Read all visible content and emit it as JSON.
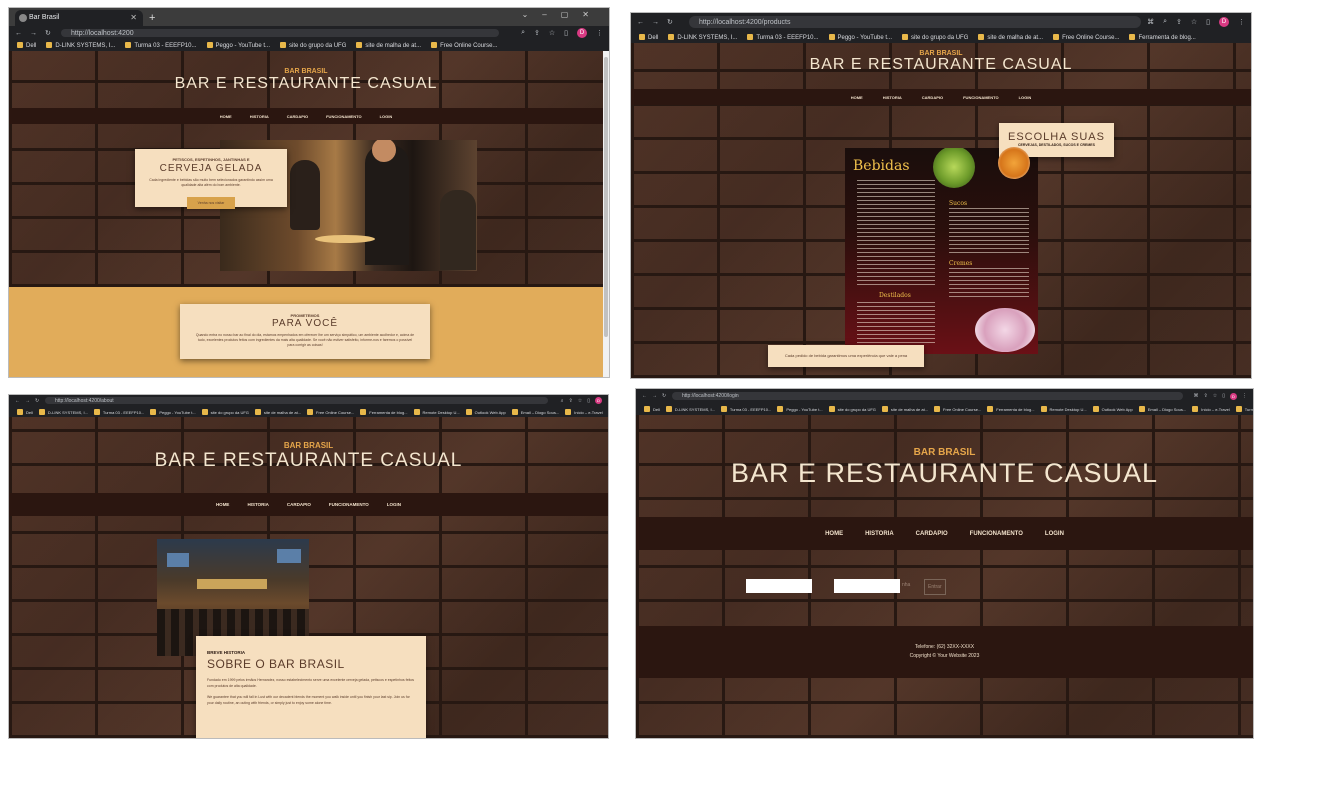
{
  "common": {
    "brand_small": "BAR BRASIL",
    "brand_big": "BAR E RESTAURANTE CASUAL",
    "nav": [
      "HOME",
      "HISTORIA",
      "CARDAPIO",
      "FUNCIONAMENTO",
      "LOGIN"
    ],
    "profile_initial": "D"
  },
  "shot1": {
    "tab_title": "Bar Brasil",
    "url": "http://localhost:4200",
    "bookmarks": [
      "Dell",
      "D-LINK SYSTEMS, I...",
      "Turma 03 - EEEFP10...",
      "Peggo - YouTube t...",
      "site do grupo da UFG",
      "site de malha de at...",
      "Free Online Course..."
    ],
    "hero_card": {
      "small": "PETISCOS, ESPETINHOS, JANTINHAS E",
      "title": "CERVEJA GELADA",
      "text": "Cada ingrediente e bebidas são muito bem selecionados garantindo assim uma qualidade alta além do bom ambiente.",
      "button": "Venha nos visitar"
    },
    "promise": {
      "small": "PROMETEMOS",
      "title": "PARA VOCÊ",
      "text": "Quando entra no nosso bar ao final do dia, estamos empenhados em oferecer lhe um serviço simpático, um ambiente acolhedor e, acima de tudo, excelentes produtos feitos com ingredientes da mais alta qualidade. Se você não estiver satisfeito, informe-nos e faremos o possível para corrigir as coisas!"
    }
  },
  "shot2": {
    "url": "http://localhost:4200/products",
    "bookmarks": [
      "Dell",
      "D-LINK SYSTEMS, I...",
      "Turma 03 - EEEFP10...",
      "Peggo - YouTube t...",
      "site do grupo da UFG",
      "site de malha de at...",
      "Free Online Course...",
      "Ferramenta de blog..."
    ],
    "card_title": "ESCOLHA SUAS",
    "card_sub": "CERVEJAS, DESTILADOS, SUCOS E CREMES",
    "menu_title": "Bebidas",
    "menu_sections": [
      "Sucos",
      "Cremes",
      "Destilados"
    ],
    "footer_card": "Cada pedido de bebida garantimos uma experiência que vale a pena"
  },
  "shot3": {
    "url": "http://localhost:4200/about",
    "bookmarks": [
      "Dell",
      "D-LINK SYSTEMS, I...",
      "Turma 03 - EEEFP10...",
      "Peggo - YouTube t...",
      "site do grupo da UFG",
      "site de malha de at...",
      "Free Online Course...",
      "Ferramenta de blog...",
      "Remote Desktop U...",
      "Outlook Web App",
      "Email – Diogo Sous...",
      "Início – e-Travel",
      "Turmas ADS1"
    ],
    "about": {
      "small": "BREVE HISTORIA",
      "title": "SOBRE O BAR BRASIL",
      "p1": "Fundado em 1999 pelos irmãos Hernandez, nosso estabelecimento serve uma excelente cerveja gelada, petiscos e espetinhos feitos com produtos de alta qualidade.",
      "p2": "We guarantee that you will fall in Lust with our decadent blends the moment you walk inside until you finish your last sip. Join us for your daily routine, an outing with friends, or simply just to enjoy some alone time."
    }
  },
  "shot4": {
    "url": "http://localhost:4200/login",
    "bookmarks": [
      "Dell",
      "D-LINK SYSTEMS, I...",
      "Turma 03 - EEEFP10...",
      "Peggo - YouTube t...",
      "site do grupo da UFG",
      "site de malha de at...",
      "Free Online Course...",
      "Ferramenta de blog...",
      "Remote Desktop U...",
      "Outlook Web App",
      "Email – Diogo Sous...",
      "Início – e-Travel",
      "Turmas ADS1"
    ],
    "login_labels": [
      "nha",
      "Entrar"
    ],
    "footer_phone": "Telefone: (62) 32XX-XXXX",
    "footer_copy": "Copyright © Your Website 2023"
  }
}
